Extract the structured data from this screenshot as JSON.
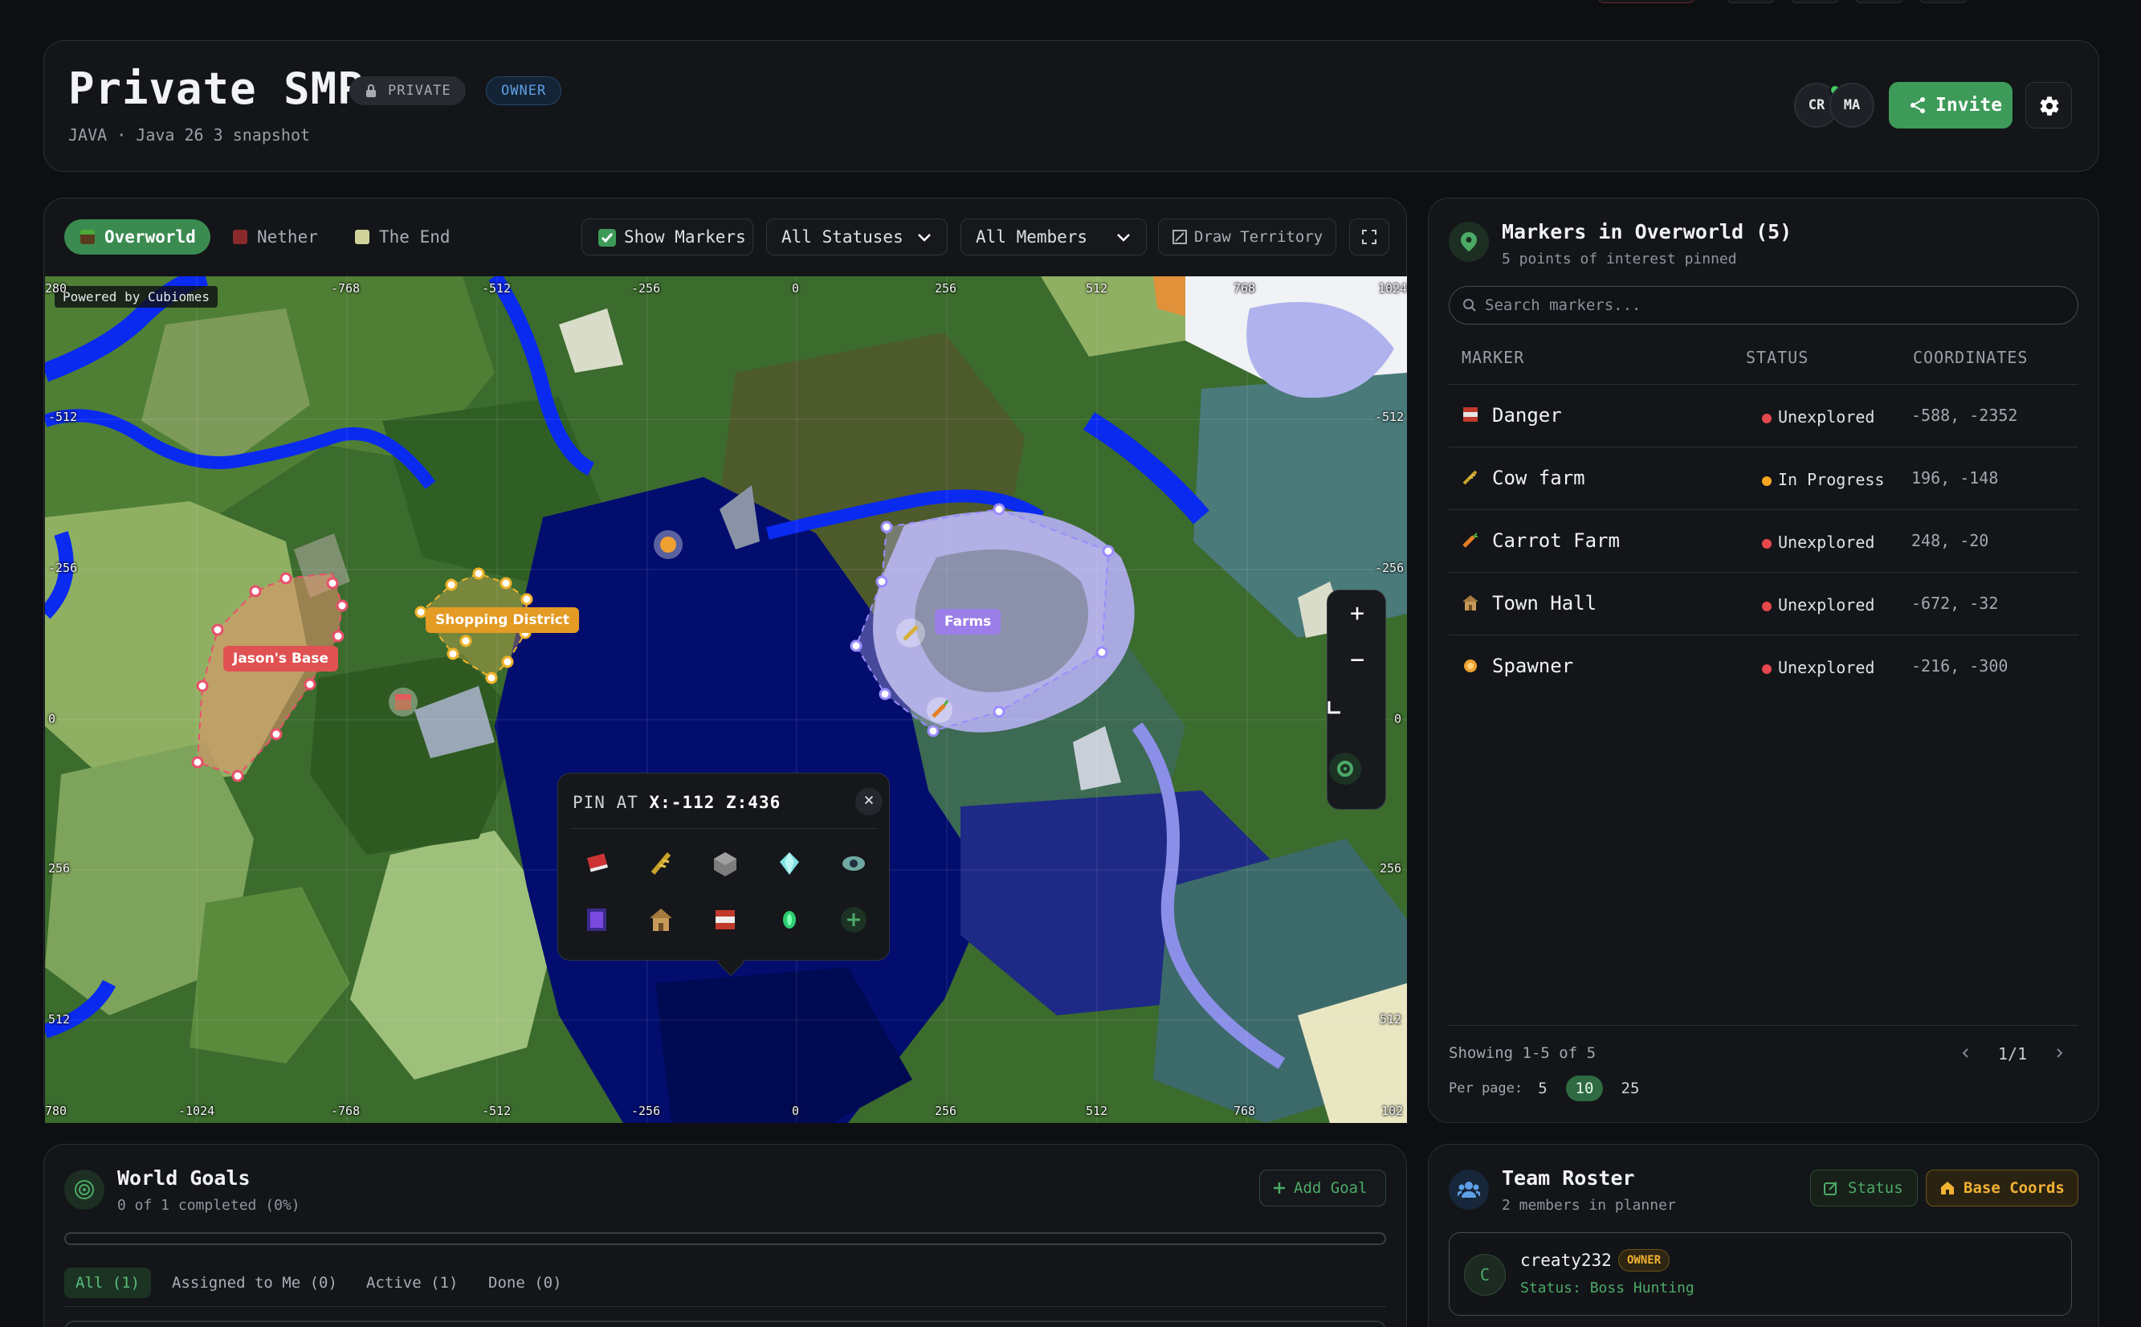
{
  "header": {
    "title": "Private SMP",
    "private_badge": "PRIVATE",
    "owner_badge": "OWNER",
    "subtitle": "JAVA · Java 26 3 snapshot",
    "avatars": [
      "CR",
      "MA"
    ],
    "invite_label": "Invite"
  },
  "map_toolbar": {
    "worlds": [
      {
        "label": "Overworld",
        "active": true
      },
      {
        "label": "Nether",
        "active": false
      },
      {
        "label": "The End",
        "active": false
      }
    ],
    "show_markers": "Show Markers",
    "status_filter": "All Statuses",
    "member_filter": "All Members",
    "draw_territory": "Draw Territory"
  },
  "map": {
    "powered_by": "Powered by Cubiomes",
    "top_ticks": [
      "-768",
      "-512",
      "-256",
      "0",
      "256",
      "512",
      "768",
      "1024"
    ],
    "bottom_ticks": [
      "-1024",
      "-768",
      "-512",
      "-256",
      "0",
      "256",
      "512",
      "768"
    ],
    "left_ticks": [
      "-512",
      "-256",
      "0",
      "256",
      "512"
    ],
    "right_ticks": [
      "-512",
      "-256",
      "0",
      "256",
      "512"
    ],
    "edge_ticks": {
      "top_left": "280",
      "bottom_left": "780",
      "bottom_right": "102"
    },
    "labels": {
      "jasons_base": "Jason's Base",
      "shopping": "Shopping District",
      "farms": "Farms"
    },
    "zoom_in": "+",
    "zoom_out": "−",
    "pin_popup": {
      "prefix": "PIN AT",
      "coords": "X:-112 Z:436",
      "close": "×",
      "icons": [
        "book-icon",
        "wheat-icon",
        "stone-icon",
        "diamond-icon",
        "ender-eye-icon",
        "portal-icon",
        "house-icon",
        "tnt-icon",
        "emerald-icon",
        "add-icon"
      ]
    }
  },
  "markers": {
    "title": "Markers in Overworld (5)",
    "subtitle": "5 points of interest pinned",
    "search_placeholder": "Search markers...",
    "columns": [
      "MARKER",
      "STATUS",
      "COORDINATES"
    ],
    "rows": [
      {
        "name": "Danger",
        "status": "Unexplored",
        "status_color": "#e5484d",
        "coords": "-588, -2352",
        "icon": "tnt-icon",
        "icon_color": "#c0392b"
      },
      {
        "name": "Cow farm",
        "status": "In Progress",
        "status_color": "#f5a623",
        "coords": "196, -148",
        "icon": "wheat-icon",
        "icon_color": "#c9a227"
      },
      {
        "name": "Carrot Farm",
        "status": "Unexplored",
        "status_color": "#e5484d",
        "coords": "248, -20",
        "icon": "carrot-icon",
        "icon_color": "#e67e22"
      },
      {
        "name": "Town Hall",
        "status": "Unexplored",
        "status_color": "#e5484d",
        "coords": "-672, -32",
        "icon": "house-icon",
        "icon_color": "#a57a3e"
      },
      {
        "name": "Spawner",
        "status": "Unexplored",
        "status_color": "#e5484d",
        "coords": "-216, -300",
        "icon": "spawner-icon",
        "icon_color": "#f0a030"
      }
    ],
    "showing": "Showing 1-5 of 5",
    "page": "1/1",
    "per_page_label": "Per page:",
    "per_page_options": [
      "5",
      "10",
      "25"
    ],
    "per_page_selected": "10"
  },
  "goals": {
    "title": "World Goals",
    "subtitle": "0 of 1 completed (0%)",
    "add_label": "Add Goal",
    "progress": 0,
    "tabs": [
      {
        "label": "All (1)",
        "active": true
      },
      {
        "label": "Assigned to Me (0)",
        "active": false
      },
      {
        "label": "Active (1)",
        "active": false
      },
      {
        "label": "Done (0)",
        "active": false
      }
    ]
  },
  "roster": {
    "title": "Team Roster",
    "subtitle": "2 members in planner",
    "status_label": "Status",
    "base_label": "Base Coords",
    "members": [
      {
        "initial": "C",
        "name": "creaty232",
        "role": "OWNER",
        "status": "Status: Boss Hunting"
      }
    ]
  },
  "colors": {
    "accent_green": "#3d9a58",
    "owner_gold": "#f2b233",
    "unexplored_red": "#e5484d",
    "in_progress_orange": "#f5a623"
  }
}
